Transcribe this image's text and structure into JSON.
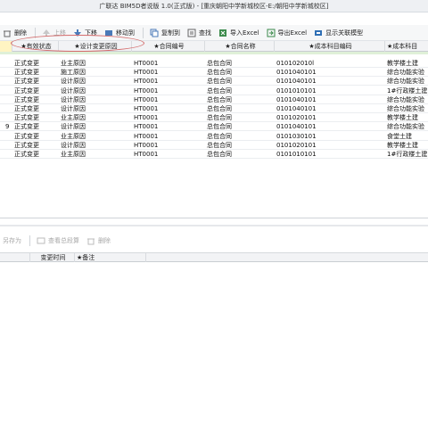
{
  "window": {
    "title": "广联达 BIM5D者说版 1.0(正式版) - [重庆朝阳中学新城校区-E:/朝阳中学新城校区]"
  },
  "toolbar": {
    "buttons": [
      {
        "label": "删除",
        "icon": "delete-icon",
        "enabled": true
      },
      {
        "label": "上移",
        "icon": "arrow-up-icon",
        "enabled": false
      },
      {
        "label": "下移",
        "icon": "arrow-down-icon",
        "enabled": true
      },
      {
        "label": "移动到",
        "icon": "move-to-icon",
        "enabled": true
      },
      {
        "label": "复制到",
        "icon": "copy-icon",
        "enabled": true
      },
      {
        "label": "查找",
        "icon": "search-icon",
        "enabled": true
      },
      {
        "label": "导入Excel",
        "icon": "import-excel-icon",
        "enabled": true
      },
      {
        "label": "导出Excel",
        "icon": "export-excel-icon",
        "enabled": true
      },
      {
        "label": "显示关联模型",
        "icon": "model-icon",
        "enabled": true
      }
    ]
  },
  "grid": {
    "headers": [
      "",
      "★有效状态",
      "★设计变更原因",
      "★合同编号",
      "★合同名称",
      "★成本科目编码",
      "★成本科目"
    ],
    "rows": [
      [
        "",
        "正式变更",
        "业主原因",
        "HT0001",
        "总包合同",
        "010102010l",
        "教学楼土建"
      ],
      [
        "",
        "正式变更",
        "施工原因",
        "HT0001",
        "总包合同",
        "0101040101",
        "综合功能实验"
      ],
      [
        "",
        "正式变更",
        "设计原因",
        "HT0001",
        "总包合同",
        "0101040101",
        "综合功能实验"
      ],
      [
        "",
        "正式变更",
        "设计原因",
        "HT0001",
        "总包合同",
        "0101010101",
        "1#行政楼土建"
      ],
      [
        "",
        "正式变更",
        "设计原因",
        "HT0001",
        "总包合同",
        "0101040101",
        "综合功能实验"
      ],
      [
        "",
        "正式变更",
        "设计原因",
        "HT0001",
        "总包合同",
        "0101040101",
        "综合功能实验"
      ],
      [
        "",
        "正式变更",
        "业主原因",
        "HT0001",
        "总包合同",
        "0101020101",
        "教学楼土建"
      ],
      [
        "",
        "正式变更",
        "设计原因",
        "HT0001",
        "总包合同",
        "0101040101",
        "综合功能实验"
      ],
      [
        "",
        "正式变更",
        "业主原因",
        "HT0001",
        "总包合同",
        "0101030101",
        "食堂土建"
      ],
      [
        "",
        "正式变更",
        "设计原因",
        "HT0001",
        "总包合同",
        "0101020101",
        "教学楼土建"
      ],
      [
        "",
        "正式变更",
        "业主原因",
        "HT0001",
        "总包合同",
        "0101010101",
        "1#行政楼土建"
      ]
    ],
    "row_markers": [
      "",
      "",
      "",
      "",
      "",
      "",
      "",
      "9",
      "",
      "",
      ""
    ]
  },
  "bottom_toolbar": {
    "buttons": [
      {
        "label": "另存为",
        "icon": "save-as-icon",
        "enabled": false
      },
      {
        "label": "查看总段算",
        "icon": "view-icon",
        "enabled": false
      },
      {
        "label": "删除",
        "icon": "delete-icon",
        "enabled": false
      }
    ]
  },
  "bottom_grid": {
    "headers": [
      "",
      "变更时间",
      "★备注"
    ]
  },
  "colors": {
    "highlight": "#fff4c2",
    "annotation": "#d46a6a",
    "accent_row": "#dff0d8"
  }
}
